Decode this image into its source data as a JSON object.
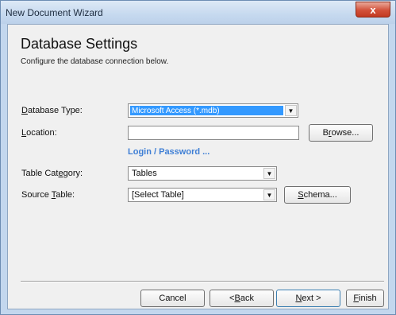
{
  "window": {
    "title": "New Document Wizard",
    "close_glyph": "x"
  },
  "header": {
    "title": "Database Settings",
    "subtitle": "Configure the database connection below."
  },
  "form": {
    "database_type": {
      "label_pre": "",
      "label_accel": "D",
      "label_post": "atabase Type:",
      "value": "Microsoft Access (*.mdb)"
    },
    "location": {
      "label_pre": "",
      "label_accel": "L",
      "label_post": "ocation:",
      "value": ""
    },
    "login_link": "Login / Password ...",
    "table_category": {
      "label_pre": "Table Cat",
      "label_accel": "e",
      "label_post": "gory:",
      "value": "Tables"
    },
    "source_table": {
      "label_pre": "Source ",
      "label_accel": "T",
      "label_post": "able:",
      "value": "[Select Table]"
    },
    "browse_button": {
      "pre": "B",
      "accel": "r",
      "post": "owse..."
    },
    "schema_button": {
      "pre": "",
      "accel": "S",
      "post": "chema..."
    }
  },
  "footer": {
    "cancel": {
      "pre": "Cancel",
      "accel": "",
      "post": ""
    },
    "back": {
      "pre": "< ",
      "accel": "B",
      "post": "ack"
    },
    "next": {
      "pre": "",
      "accel": "N",
      "post": "ext >"
    },
    "finish": {
      "pre": "",
      "accel": "F",
      "post": "inish"
    }
  },
  "colors": {
    "selection": "#3399ff",
    "link": "#3f7fd5",
    "close_button": "#c8452c"
  },
  "icons": {
    "dropdown": "chevron-down-icon"
  }
}
